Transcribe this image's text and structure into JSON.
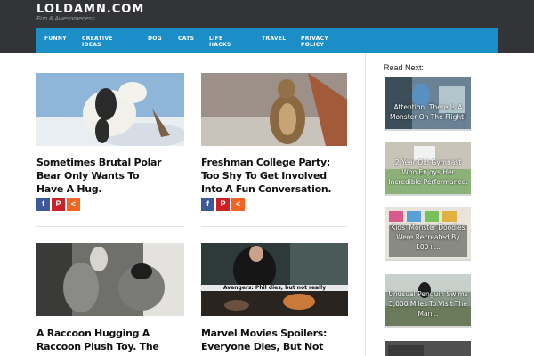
{
  "site": {
    "name": "LOLDAMN.COM",
    "tagline": "Fun & Awesomeness"
  },
  "nav": {
    "items": [
      {
        "label": "FUNNY"
      },
      {
        "label": "CREATIVE\nIDEAS"
      },
      {
        "label": "DOG"
      },
      {
        "label": "CATS"
      },
      {
        "label": "LIFE\nHACKS"
      },
      {
        "label": "TRAVEL"
      },
      {
        "label": "PRIVACY\nPOLICY"
      }
    ]
  },
  "posts": [
    {
      "title": "Sometimes Brutal Polar Bear Only Wants To Have A Hug.",
      "image": "polar-bear-photo"
    },
    {
      "title": "Freshman College Party: Too Shy To Get Involved Into A Fun Conversation.",
      "image": "squirrel-photo"
    },
    {
      "title": "A Raccoon Hugging A Raccoon Plush Toy. The",
      "image": "raccoon-photo"
    },
    {
      "title": "Marvel Movies Spoilers: Everyone Dies, But Not",
      "image": "marvel-still",
      "image_caption": "Avengers: Phil dies, but not really"
    }
  ],
  "share_icons": [
    "facebook-icon",
    "pinterest-icon",
    "share-icon"
  ],
  "sidebar": {
    "title": "Read Next:",
    "items": [
      {
        "label": "Attention, There Is A Monster On The Flight!"
      },
      {
        "label": "2 Year Old Gymnast Who Enjoys Her Incredible Performance."
      },
      {
        "label": "Kids' Monster Doodles Were Recreated By 100+..."
      },
      {
        "label": "Unusual Penguin Swims 5,000 Miles To Visit The Man..."
      }
    ]
  },
  "colors": {
    "header_bg": "#333438",
    "nav_bg": "#1b8ec7",
    "facebook": "#3b5998",
    "pinterest": "#cb2027",
    "share": "#f26522"
  }
}
